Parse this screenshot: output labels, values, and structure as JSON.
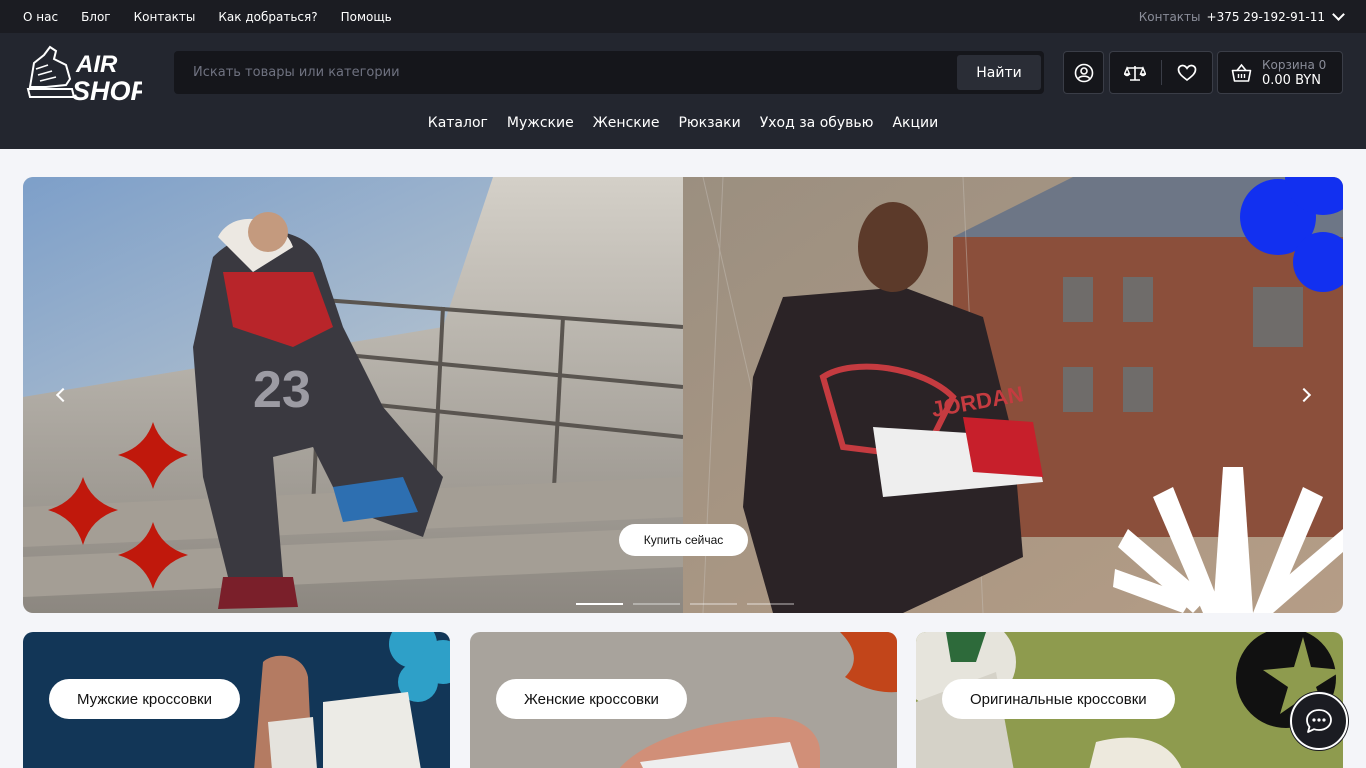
{
  "topbar": {
    "links": [
      "О нас",
      "Блог",
      "Контакты",
      "Как добраться?",
      "Помощь"
    ],
    "contacts_label": "Контакты",
    "phone": "+375 29-192-91-11"
  },
  "header": {
    "logo_text_top": "AIR",
    "logo_text_bottom": "SHOP",
    "search_placeholder": "Искать товары или категории",
    "search_button": "Найти",
    "cart_label": "Корзина 0",
    "cart_total": "0.00 BYN"
  },
  "nav": {
    "items": [
      "Каталог",
      "Мужские",
      "Женские",
      "Рюкзаки",
      "Уход за обувью",
      "Акции"
    ]
  },
  "hero": {
    "cta": "Купить сейчас",
    "slide_count": 4,
    "active_slide": 1,
    "brand_text": "JORDAN",
    "jersey_number": "23"
  },
  "categories": [
    {
      "label": "Мужские кроссовки"
    },
    {
      "label": "Женские кроссовки"
    },
    {
      "label": "Оригинальные кроссовки"
    }
  ],
  "colors": {
    "topbar_bg": "#1b1c22",
    "header_bg": "#23262f",
    "page_bg": "#f4f5f9",
    "accent_red": "#c0180c",
    "accent_blue": "#1230f0"
  },
  "icons": {
    "user": "user-circle-icon",
    "compare": "scales-icon",
    "favorites": "heart-icon",
    "cart": "basket-icon",
    "chat": "chat-bubble-icon"
  }
}
